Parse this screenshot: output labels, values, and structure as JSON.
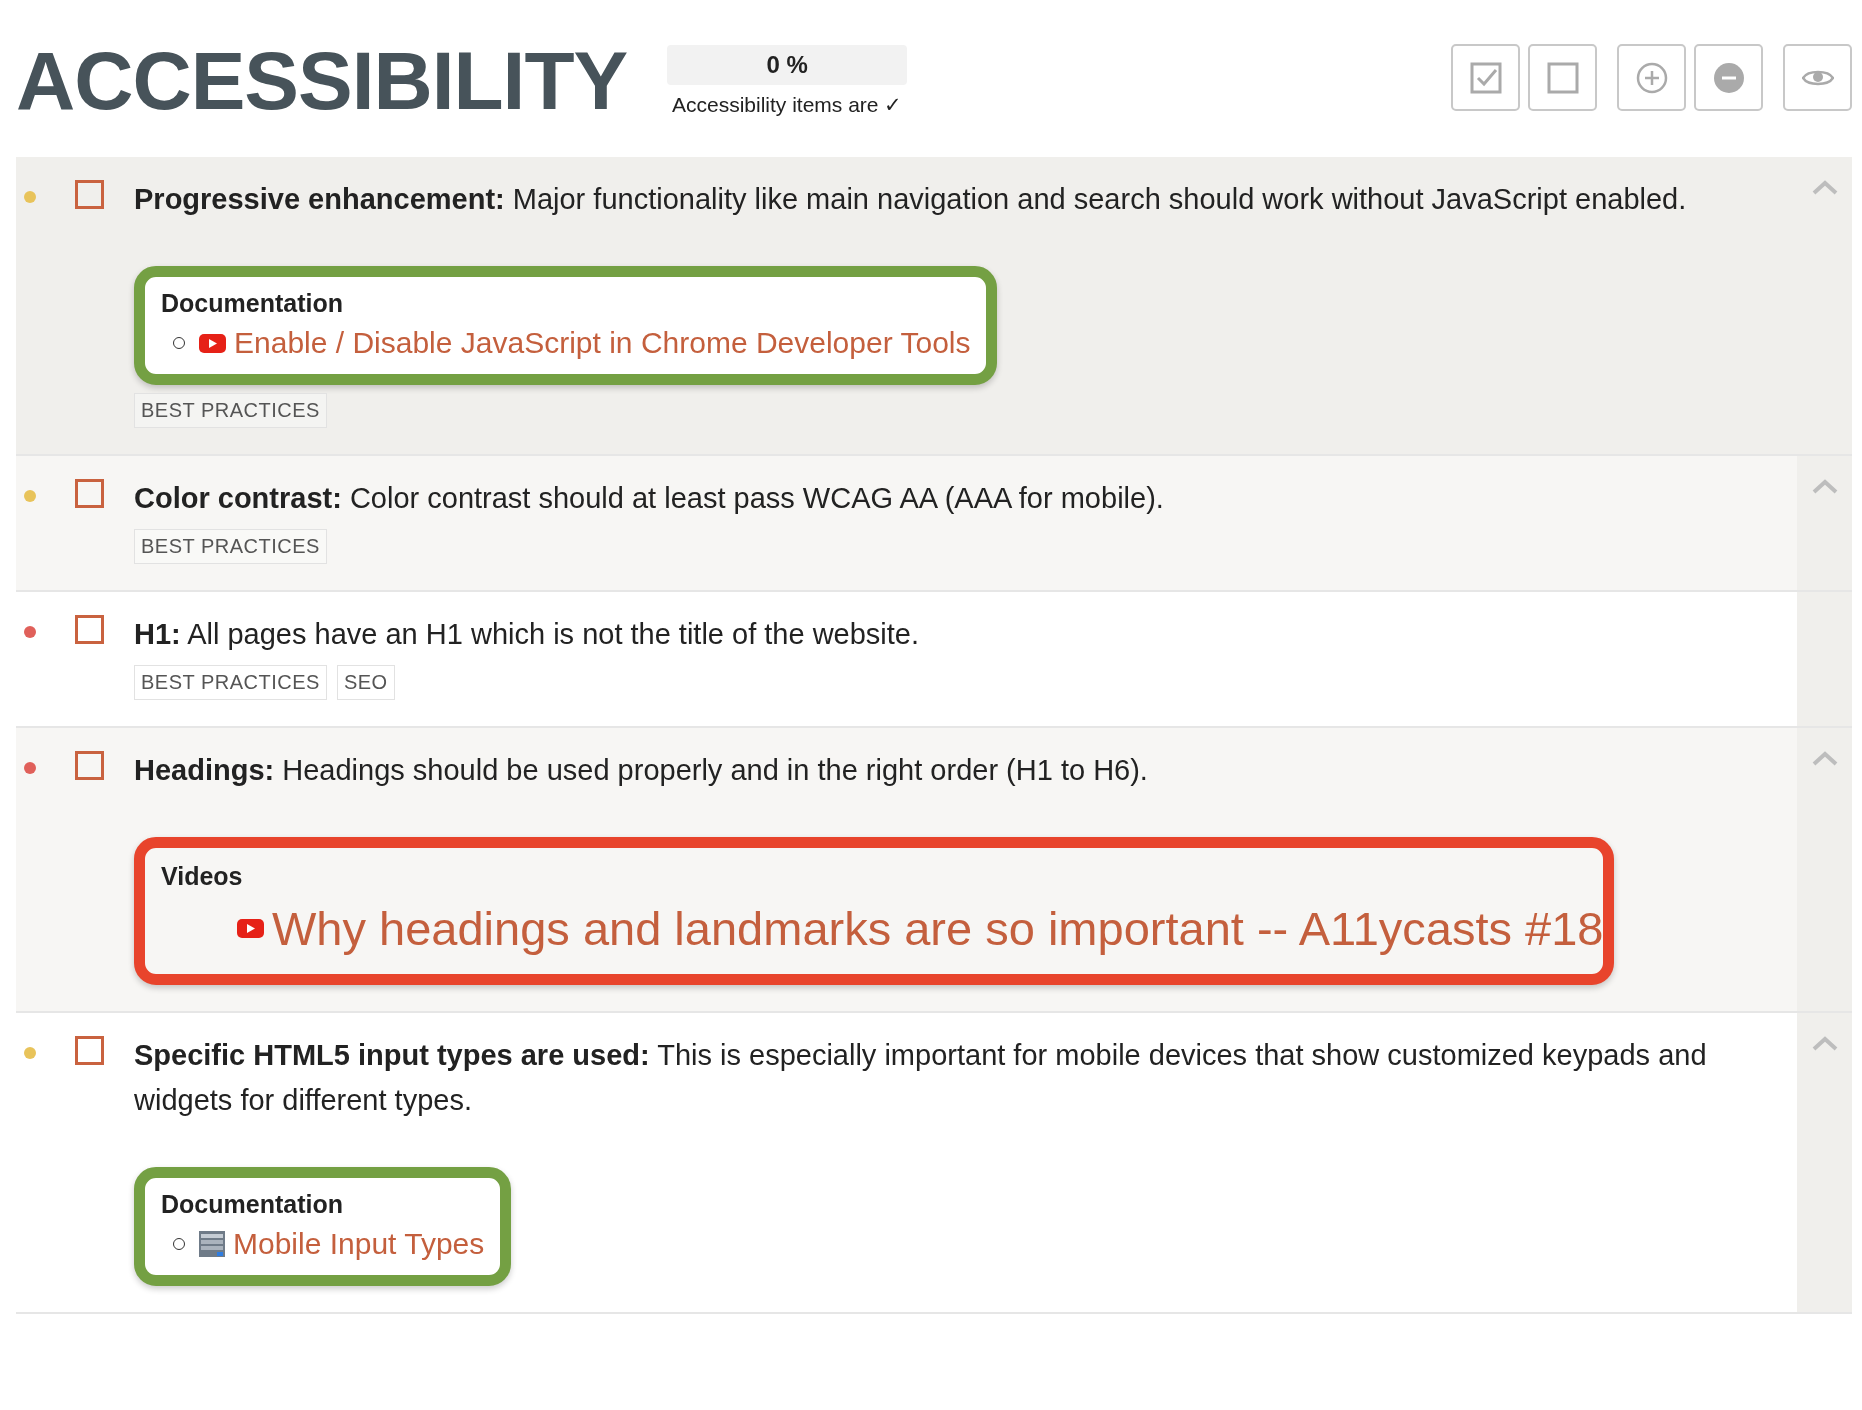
{
  "header": {
    "title": "ACCESSIBILITY",
    "progress": {
      "reading": "0 %",
      "level": 0,
      "caption": "Accessibility items are ✓"
    }
  },
  "items": [
    {
      "color": "#e8c35a",
      "checked": false,
      "highlighted": true,
      "expandable": true,
      "text": "**Progressive enhancement:** Major functionality like main navigation and search should work without JavaScript enabled.",
      "resources": [
        {
          "kind": "list",
          "heading": "Documentation",
          "color": "#74a043",
          "links": [
            {
              "kind": "video",
              "text": "Enable / Disable JavaScript in Chrome Developer Tools"
            }
          ]
        }
      ],
      "tags": [
        "BEST PRACTICES"
      ]
    },
    {
      "color": "#e8c35a",
      "checked": false,
      "highlighted": false,
      "expandable": true,
      "text": "**Color contrast:** Color contrast should at least pass WCAG AA (AAA for mobile).",
      "tags": [
        "BEST PRACTICES"
      ]
    },
    {
      "color": "#e0605a",
      "checked": false,
      "highlighted": false,
      "expandable": false,
      "text": "**H1:** All pages have an H1 which is not the title of the website.",
      "tags": [
        "BEST PRACTICES",
        "SEO"
      ]
    },
    {
      "color": "#e0605a",
      "checked": false,
      "highlighted": false,
      "expandable": true,
      "text": "**Headings:** Headings should be used properly and in the right order (H1 to H6).",
      "resources": [
        {
          "kind": "feature",
          "heading": "Videos",
          "color": "#e8442c",
          "links": [
            {
              "kind": "video",
              "text": "Why headings and landmarks are so important -- A11ycasts #18"
            }
          ]
        }
      ]
    },
    {
      "color": "#e8c35a",
      "checked": false,
      "highlighted": false,
      "expandable": true,
      "text": "**Specific HTML5 input types are used:** This is especially important for mobile devices that show customized keypads and widgets for different types.",
      "resources": [
        {
          "kind": "list",
          "heading": "Documentation",
          "color": "#74a043",
          "links": [
            {
              "kind": "screenshot",
              "text": "Mobile Input Types"
            }
          ]
        }
      ]
    }
  ]
}
